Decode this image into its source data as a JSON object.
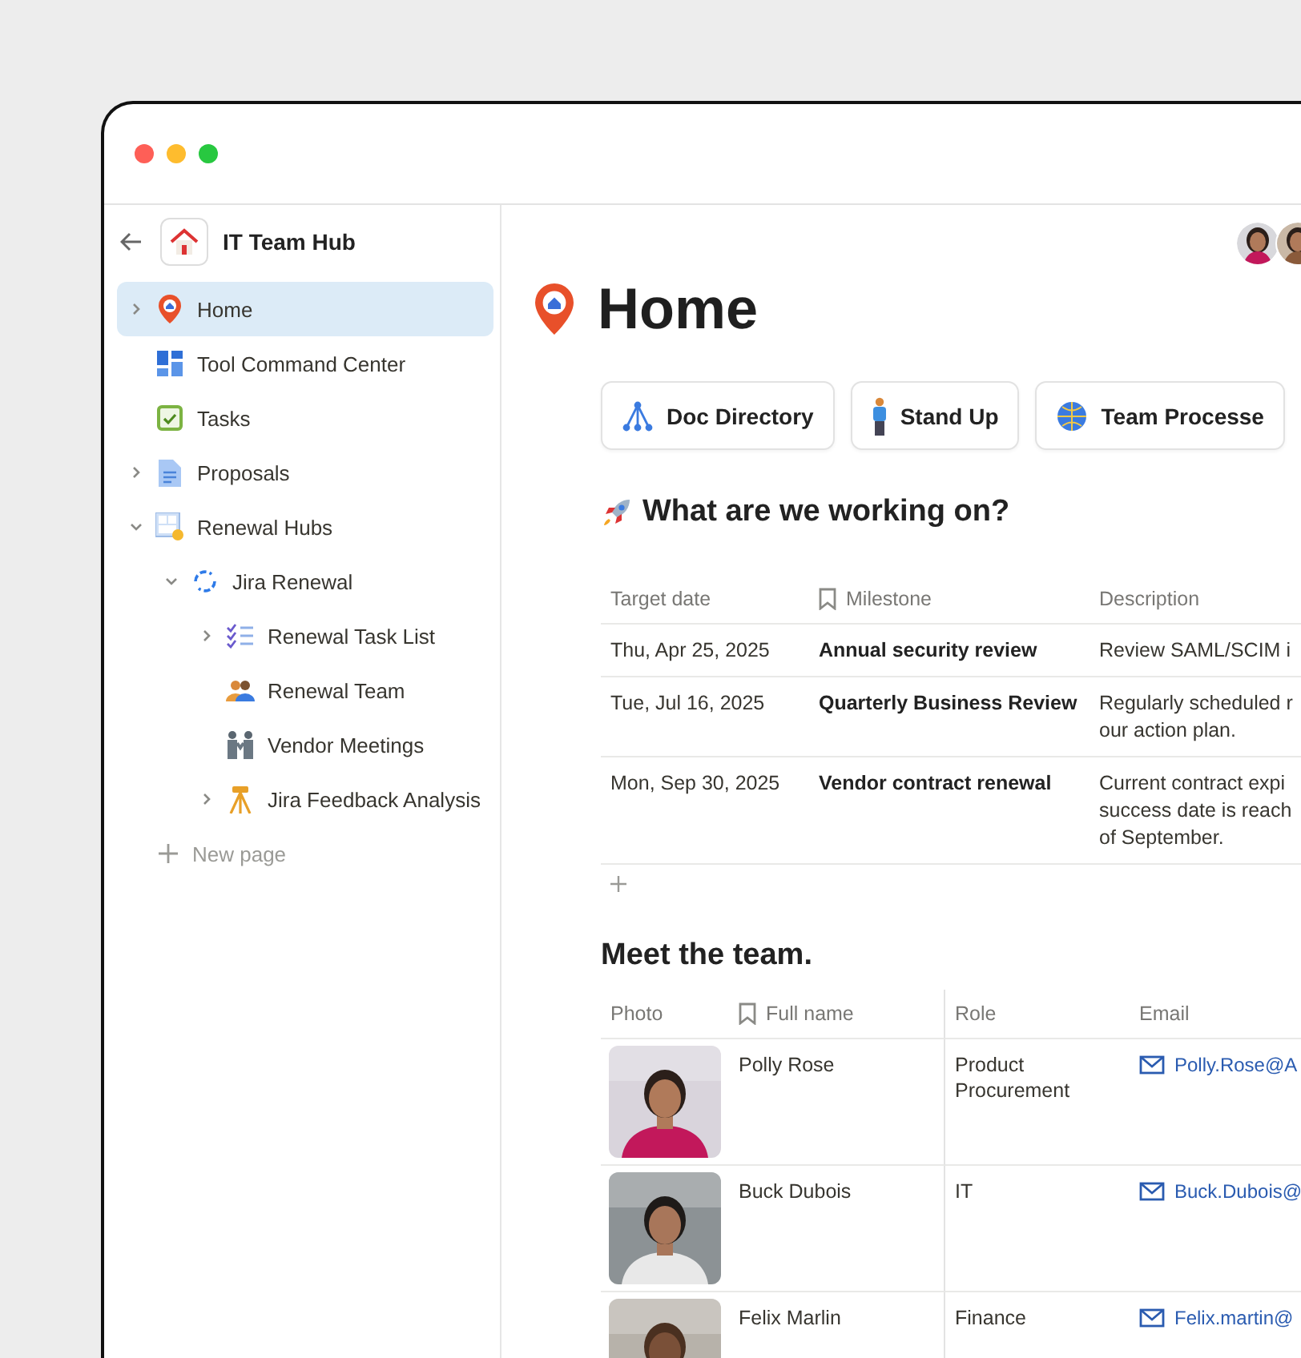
{
  "sidebar": {
    "workspace_title": "IT Team Hub",
    "items": [
      {
        "label": "Home",
        "selected": true,
        "expanded": false
      },
      {
        "label": "Tool Command Center",
        "selected": false
      },
      {
        "label": "Tasks",
        "selected": false
      },
      {
        "label": "Proposals",
        "selected": false,
        "expanded": false
      },
      {
        "label": "Renewal Hubs",
        "selected": false,
        "expanded": true,
        "children": [
          {
            "label": "Jira Renewal",
            "selected": false,
            "expanded": true,
            "children": [
              {
                "label": "Renewal Task List",
                "selected": false,
                "expanded": false
              },
              {
                "label": "Renewal Team",
                "selected": false
              },
              {
                "label": "Vendor Meetings",
                "selected": false
              },
              {
                "label": "Jira Feedback Analysis",
                "selected": false,
                "expanded": false
              }
            ]
          }
        ]
      }
    ],
    "new_page": "New page"
  },
  "page": {
    "title": "Home",
    "links": [
      {
        "label": "Doc Directory"
      },
      {
        "label": "Stand Up"
      },
      {
        "label": "Team Processe"
      }
    ],
    "milestones": {
      "heading": "What are we working on?",
      "columns": [
        "Target date",
        "Milestone",
        "Description"
      ],
      "rows": [
        {
          "date": "Thu, Apr 25, 2025",
          "milestone": "Annual security review",
          "description": [
            "Review SAML/SCIM i"
          ]
        },
        {
          "date": "Tue, Jul 16, 2025",
          "milestone": "Quarterly Business Review",
          "description": [
            "Regularly scheduled r",
            "our action plan."
          ]
        },
        {
          "date": "Mon, Sep 30, 2025",
          "milestone": "Vendor contract renewal",
          "description": [
            "Current contract expi",
            "success date is reach",
            "of September."
          ]
        }
      ]
    },
    "team": {
      "heading": "Meet the team.",
      "columns": [
        "Photo",
        "Full name",
        "Role",
        "Email"
      ],
      "rows": [
        {
          "name": "Polly Rose",
          "role": "Product Procurement",
          "email": "Polly.Rose@A"
        },
        {
          "name": "Buck Dubois",
          "role": "IT",
          "email": "Buck.Dubois@"
        },
        {
          "name": "Felix Marlin",
          "role": "Finance",
          "email": "Felix.martin@"
        }
      ]
    }
  }
}
